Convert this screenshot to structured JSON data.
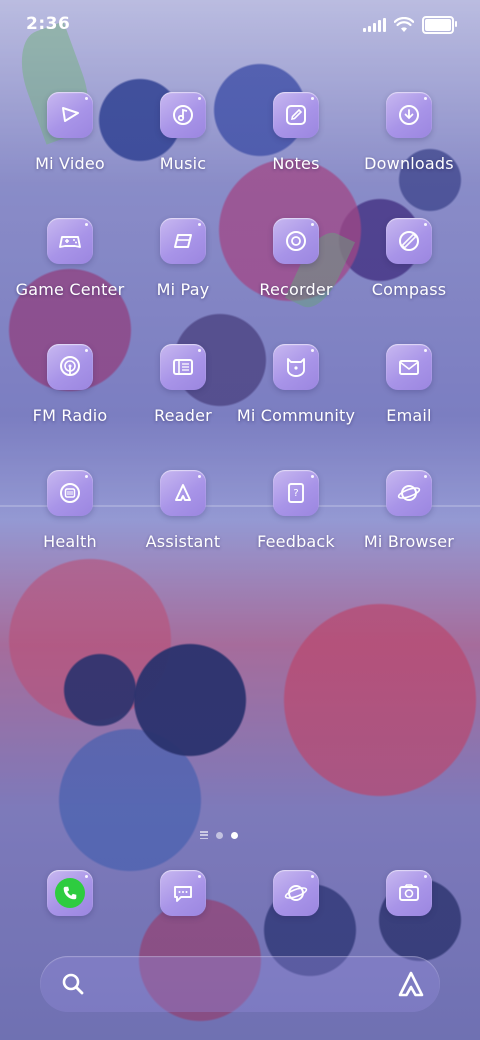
{
  "status_bar": {
    "time": "2:36",
    "icons": [
      "signal-icon",
      "wifi-icon",
      "battery-icon"
    ],
    "battery_level": 1.0
  },
  "apps": [
    {
      "label": "Mi Video",
      "icon": "play-icon"
    },
    {
      "label": "Music",
      "icon": "music-note-icon"
    },
    {
      "label": "Notes",
      "icon": "pencil-icon"
    },
    {
      "label": "Downloads",
      "icon": "download-icon"
    },
    {
      "label": "Game Center",
      "icon": "gamepad-icon"
    },
    {
      "label": "Mi Pay",
      "icon": "card-icon"
    },
    {
      "label": "Recorder",
      "icon": "record-icon"
    },
    {
      "label": "Compass",
      "icon": "compass-icon"
    },
    {
      "label": "FM Radio",
      "icon": "radio-icon"
    },
    {
      "label": "Reader",
      "icon": "book-icon"
    },
    {
      "label": "Mi Community",
      "icon": "bear-icon"
    },
    {
      "label": "Email",
      "icon": "envelope-icon"
    },
    {
      "label": "Health",
      "icon": "watch-icon"
    },
    {
      "label": "Assistant",
      "icon": "assistant-icon"
    },
    {
      "label": "Feedback",
      "icon": "question-icon"
    },
    {
      "label": "Mi Browser",
      "icon": "planet-icon"
    }
  ],
  "page_indicator": {
    "pages": 2,
    "current": 2
  },
  "dock": [
    {
      "name": "phone",
      "icon": "phone-icon"
    },
    {
      "name": "messages",
      "icon": "chat-icon"
    },
    {
      "name": "browser",
      "icon": "planet-icon"
    },
    {
      "name": "camera",
      "icon": "camera-icon"
    }
  ],
  "search_bar": {
    "left_icon": "search-icon",
    "right_icon": "assistant-icon"
  },
  "colors": {
    "icon_tile": "#a894e8",
    "phone_green": "#2ecc40",
    "text": "#ffffff"
  }
}
